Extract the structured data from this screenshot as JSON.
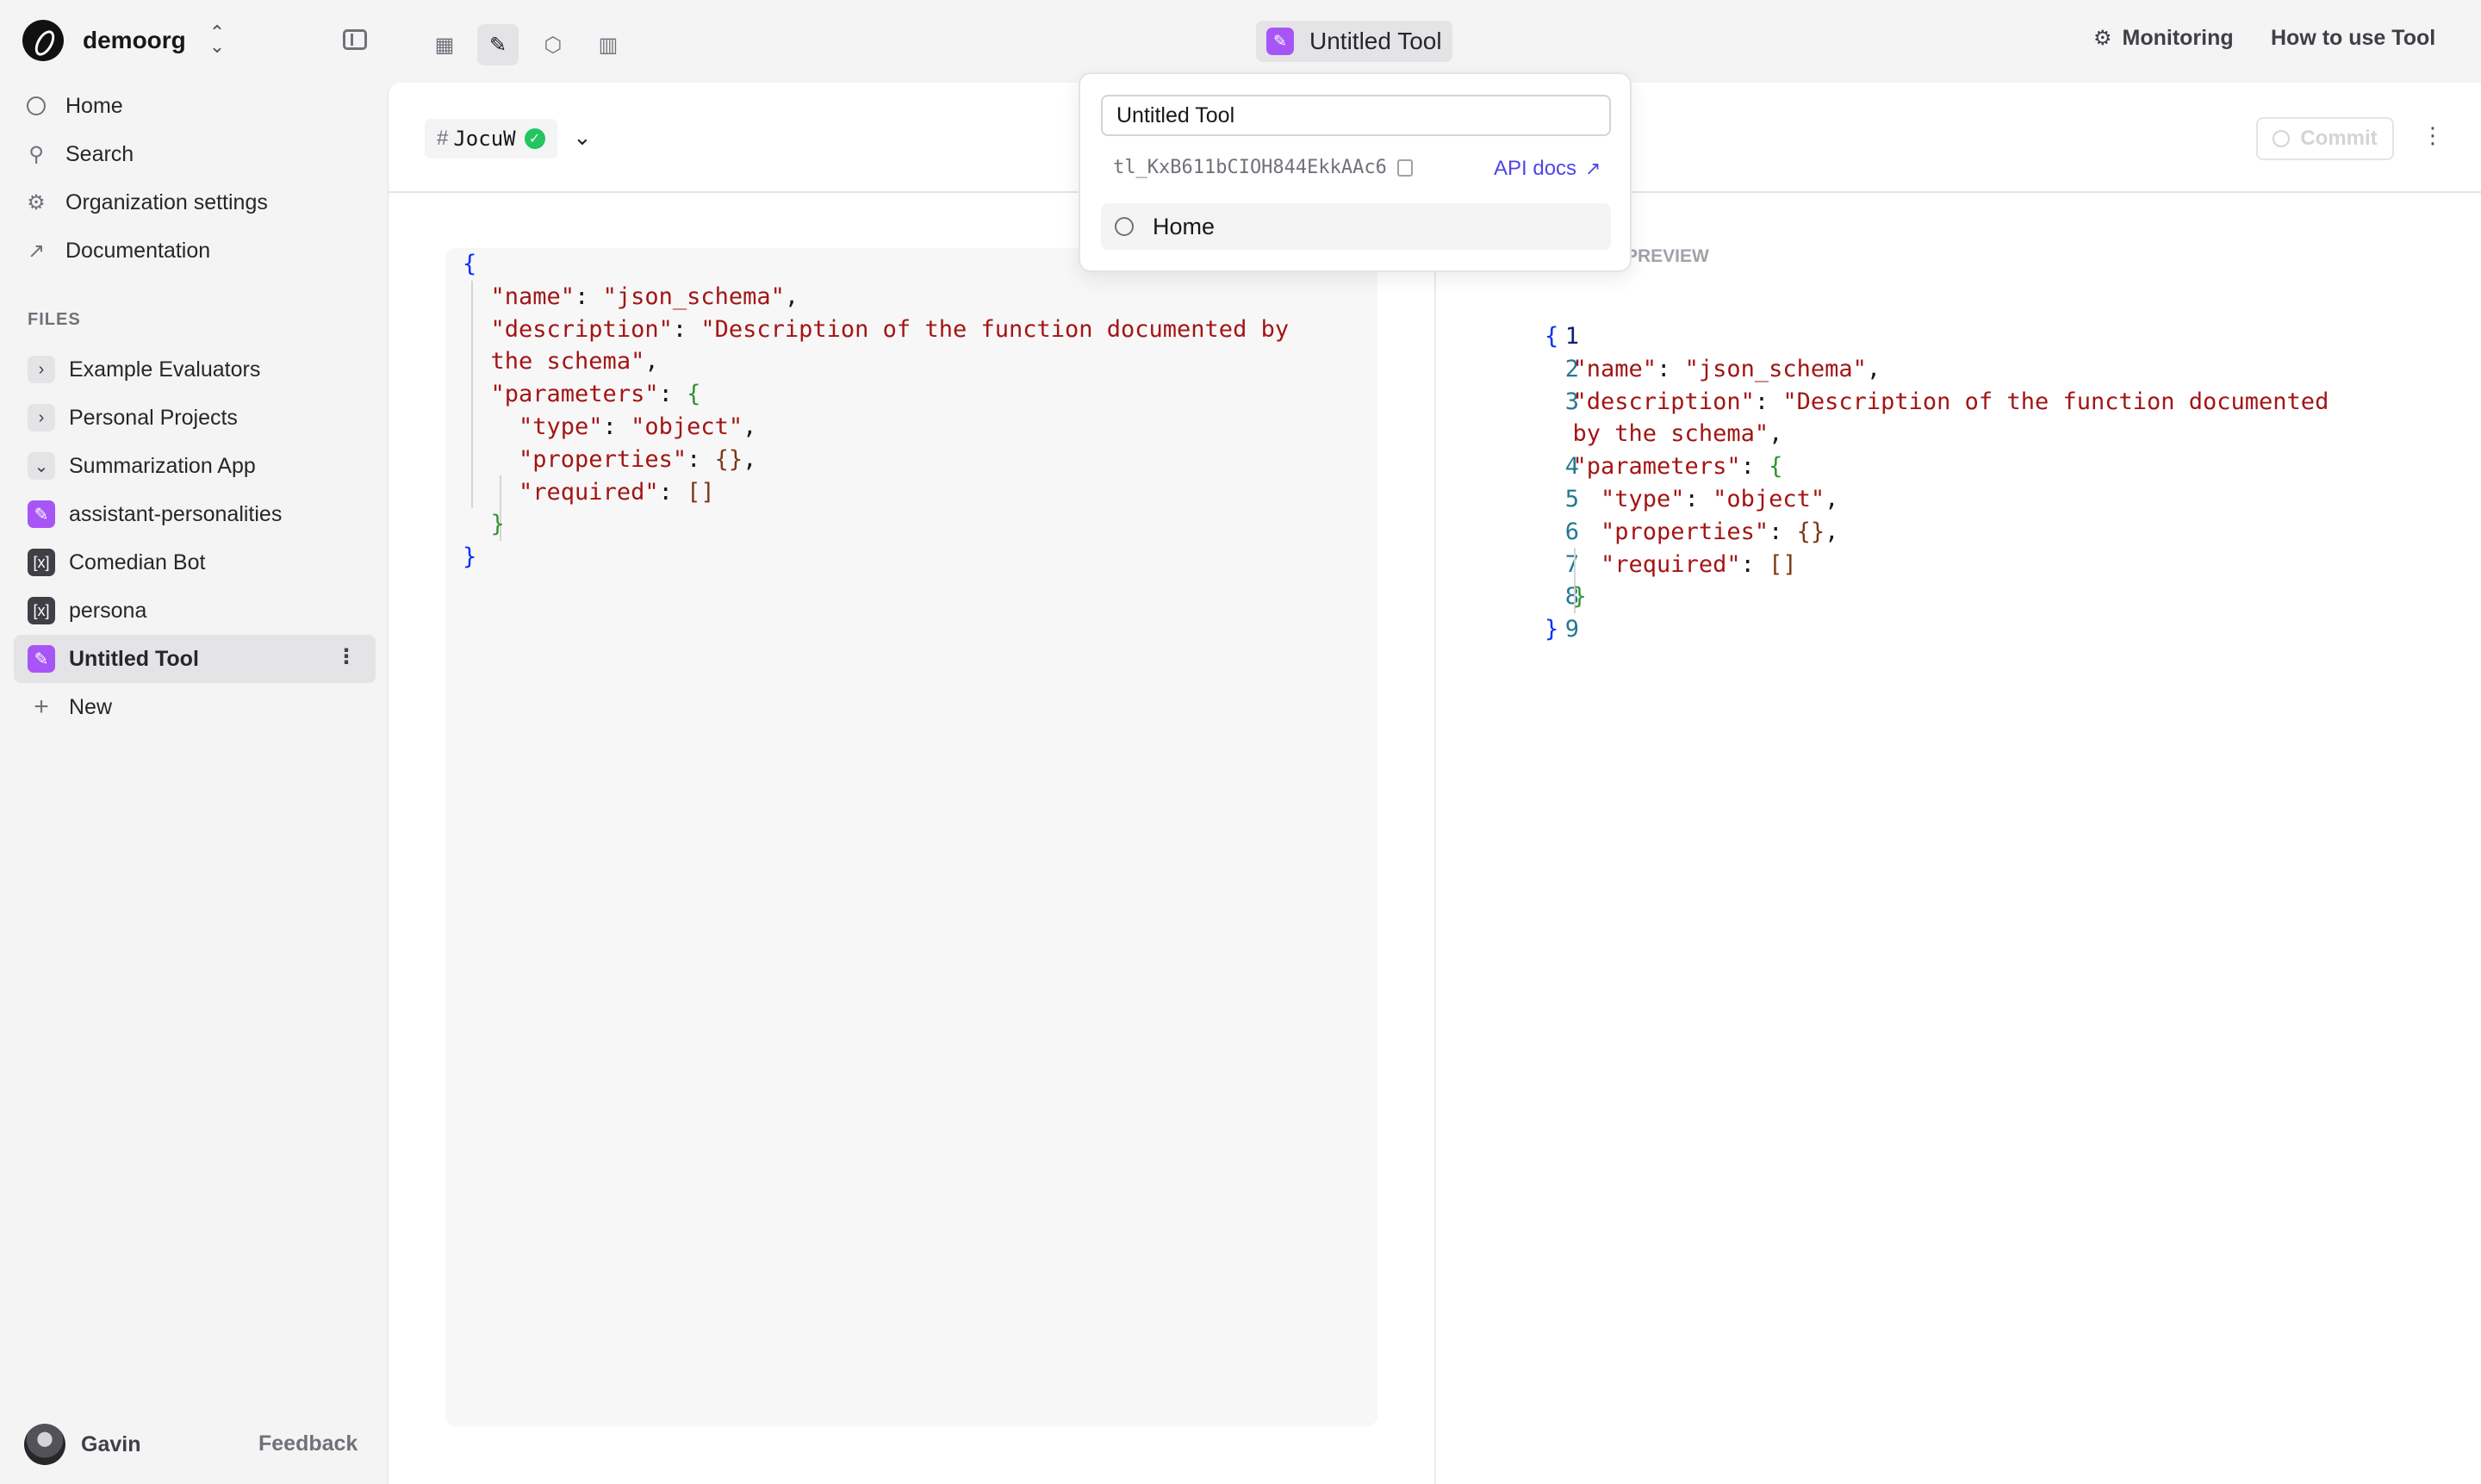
{
  "org": {
    "name": "demoorg"
  },
  "nav": [
    {
      "label": "Home",
      "icon": "home-ring-icon"
    },
    {
      "label": "Search",
      "icon": "search-icon"
    },
    {
      "label": "Organization settings",
      "icon": "gear-icon"
    },
    {
      "label": "Documentation",
      "icon": "arrow-up-right-icon"
    }
  ],
  "files": {
    "label": "FILES",
    "items": [
      {
        "label": "Example Evaluators",
        "icon": "chevron-right-icon"
      },
      {
        "label": "Personal Projects",
        "icon": "chevron-right-icon"
      },
      {
        "label": "Summarization App",
        "icon": "chevron-down-icon"
      },
      {
        "label": "assistant-personalities",
        "icon": "tool-icon"
      },
      {
        "label": "Comedian Bot",
        "icon": "prompt-icon"
      },
      {
        "label": "persona",
        "icon": "prompt-icon"
      },
      {
        "label": "Untitled Tool",
        "icon": "tool-icon"
      },
      {
        "label": "New",
        "icon": "plus-icon"
      }
    ]
  },
  "user": {
    "name": "Gavin",
    "feedback_label": "Feedback"
  },
  "topbar": {
    "title": "Untitled Tool",
    "monitoring_label": "Monitoring",
    "howto_label": "How to use Tool"
  },
  "version": {
    "id": "JocuW",
    "status": "committed"
  },
  "commit_label": "Commit",
  "preview_label": "PREVIEW",
  "popover": {
    "name_value": "Untitled Tool",
    "tool_id": "tl_KxB611bCIOH844EkkAAc6",
    "api_docs_label": "API docs",
    "home_label": "Home"
  },
  "schema": {
    "name_key": "\"name\"",
    "name_value": "\"json_schema\"",
    "description_key": "\"description\"",
    "description_value": "\"Description of the function documented by the schema\"",
    "parameters_key": "\"parameters\"",
    "type_key": "\"type\"",
    "type_value": "\"object\"",
    "properties_key": "\"properties\"",
    "required_key": "\"required\""
  },
  "line_numbers": [
    "1",
    "2",
    "3",
    "4",
    "5",
    "6",
    "7",
    "8",
    "9"
  ],
  "colors": {
    "accent": "#a855f7",
    "link": "#4f46e5",
    "success": "#22c55e"
  }
}
